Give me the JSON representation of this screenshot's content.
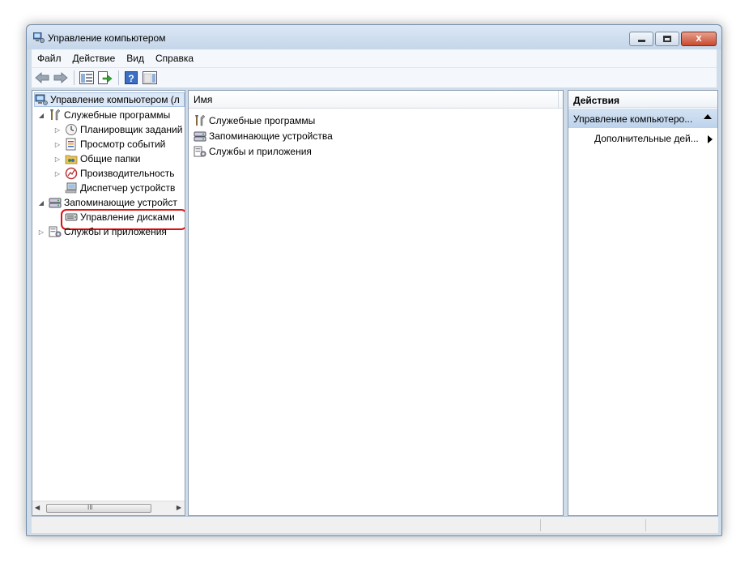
{
  "window": {
    "title": "Управление компьютером",
    "close_glyph": "x"
  },
  "menu": [
    "Файл",
    "Действие",
    "Вид",
    "Справка"
  ],
  "toolbar": {
    "icons": [
      "back-icon",
      "forward-icon",
      "show-hide-tree-icon",
      "export-list-icon",
      "help-icon",
      "action-pane-icon"
    ],
    "help_glyph": "?"
  },
  "tree": {
    "root": "Управление компьютером (л",
    "system_tools": "Служебные программы",
    "task_scheduler": "Планировщик заданий",
    "event_viewer": "Просмотр событий",
    "shared_folders": "Общие папки",
    "performance": "Производительность",
    "device_manager": "Диспетчер устройств",
    "storage": "Запоминающие устройст",
    "disk_management": "Управление дисками",
    "services_apps": "Службы и приложения",
    "scroll_grip": "III"
  },
  "list": {
    "column_name": "Имя",
    "items": [
      "Служебные программы",
      "Запоминающие устройства",
      "Службы и приложения"
    ]
  },
  "actions": {
    "header": "Действия",
    "group": "Управление компьютеро...",
    "more": "Дополнительные дей..."
  },
  "colors": {
    "highlight_ring": "#e01010",
    "close_button": "#c84a2e",
    "window_frame": "#cfdcea"
  }
}
